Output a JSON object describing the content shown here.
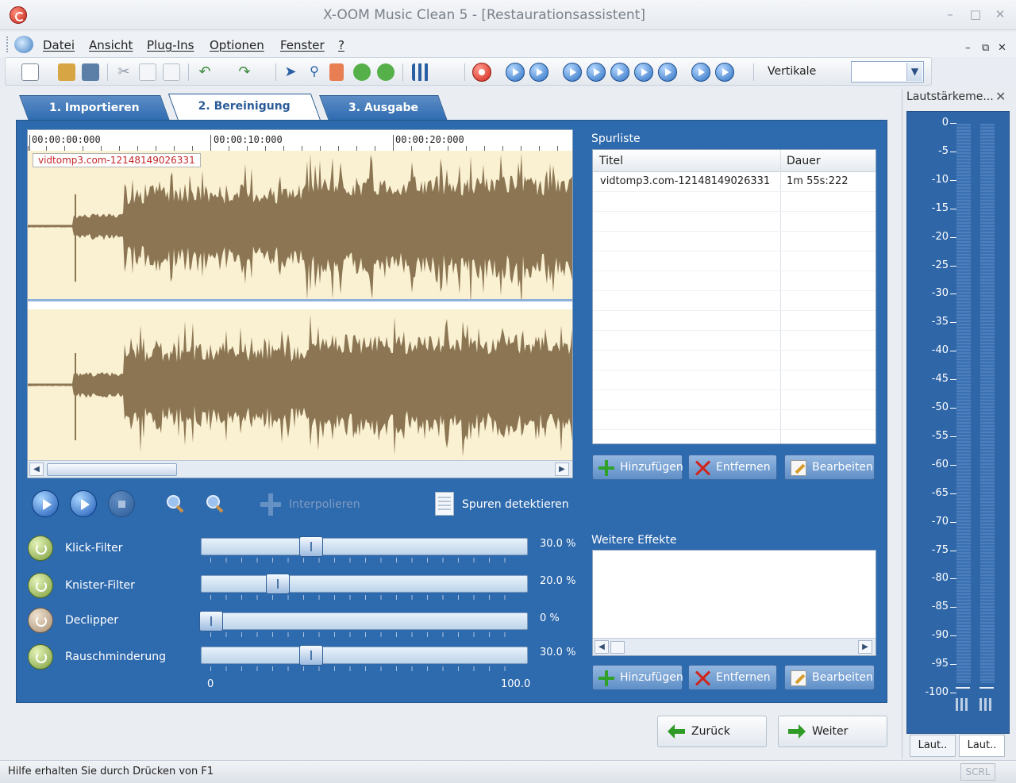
{
  "window": {
    "title": "X-OOM Music Clean 5 - [Restaurationsassistent]"
  },
  "menu": {
    "items": [
      "Datei",
      "Ansicht",
      "Plug-Ins",
      "Optionen",
      "Fenster",
      "?"
    ]
  },
  "toolbar": {
    "vertikale_label": "Vertikale",
    "vertikale_value": ""
  },
  "tabs": [
    {
      "label": "1. Importieren"
    },
    {
      "label": "2. Bereinigung",
      "active": true
    },
    {
      "label": "3. Ausgabe"
    }
  ],
  "waveform": {
    "time_labels": [
      "00:00:00:000",
      "00:00:10:000",
      "00:00:20:000"
    ],
    "file_tag": "vidtomp3.com-12148149026331"
  },
  "transport": {
    "interpolate_label": "Interpolieren",
    "detect_tracks_label": "Spuren detektieren"
  },
  "filters": [
    {
      "name": "Klick-Filter",
      "value": 30.0,
      "value_text": "30.0 %",
      "enabled": true
    },
    {
      "name": "Knister-Filter",
      "value": 20.0,
      "value_text": "20.0 %",
      "enabled": true
    },
    {
      "name": "Declipper",
      "value": 0,
      "value_text": "0 %",
      "enabled": false
    },
    {
      "name": "Rauschminderung",
      "value": 30.0,
      "value_text": "30.0 %",
      "enabled": true
    }
  ],
  "slider_scale": {
    "min": "0",
    "max": "100.0"
  },
  "track_list": {
    "title": "Spurliste",
    "columns": [
      "Titel",
      "Dauer"
    ],
    "rows": [
      {
        "title": "vidtomp3.com-12148149026331",
        "duration": "1m 55s:222"
      }
    ]
  },
  "effects_list": {
    "title": "Weitere Effekte"
  },
  "list_buttons": {
    "add": "Hinzufügen",
    "remove": "Entfernen",
    "edit": "Bearbeiten"
  },
  "navigation": {
    "back": "Zurück",
    "next": "Weiter"
  },
  "meter": {
    "title": "Lautstärkeme...",
    "scale": [
      "0",
      "-5",
      "-10",
      "-15",
      "-20",
      "-25",
      "-30",
      "-35",
      "-40",
      "-45",
      "-50",
      "-55",
      "-60",
      "-65",
      "-70",
      "-75",
      "-80",
      "-85",
      "-90",
      "-95",
      "-100"
    ],
    "tabs": [
      "Laut..",
      "Laut.."
    ]
  },
  "status": {
    "text": "Hilfe erhalten Sie durch Drücken von F1",
    "scrl": "SCRL"
  },
  "colors": {
    "panel": "#2e6aae",
    "waveform": "#8b7553",
    "wave_bg": "#f9f1d2"
  }
}
